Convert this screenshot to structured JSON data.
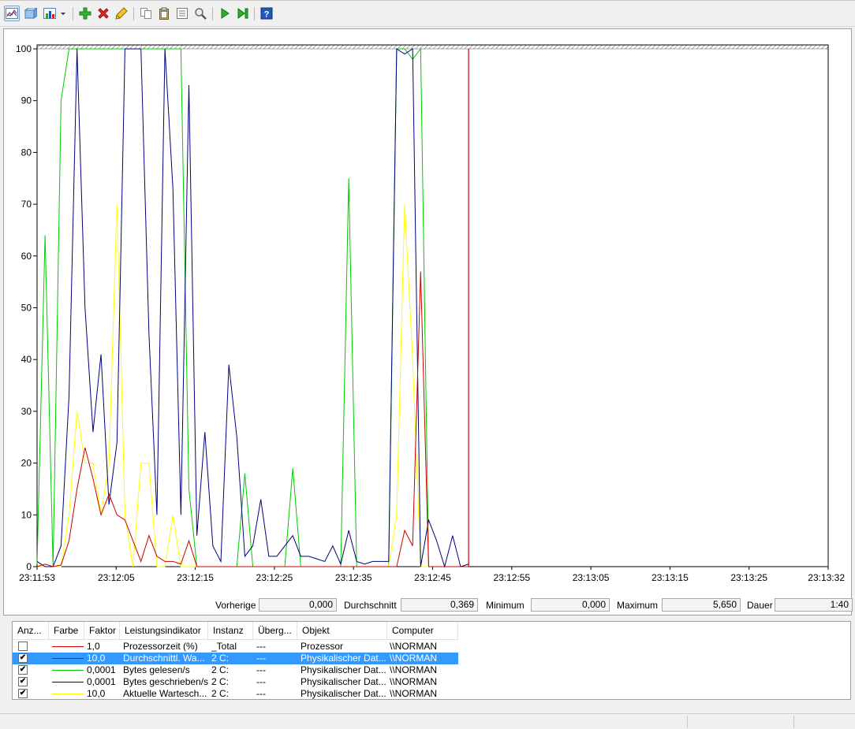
{
  "toolbar": {
    "buttons": [
      {
        "icon": "graph-view-icon",
        "active": true
      },
      {
        "icon": "change-graph-type-icon"
      },
      {
        "icon": "graph-type-dropdown-icon"
      },
      {
        "icon": "add-counter-icon",
        "color": "#2fa22f"
      },
      {
        "icon": "delete-counter-icon",
        "color": "#d02020"
      },
      {
        "icon": "highlight-icon",
        "color": "#c9a000"
      },
      {
        "icon": "copy-properties-icon"
      },
      {
        "icon": "paste-counter-list-icon"
      },
      {
        "icon": "properties-icon"
      },
      {
        "icon": "zoom-icon"
      },
      {
        "icon": "unfreeze-display-icon",
        "color": "#1e9a1e"
      },
      {
        "icon": "update-data-icon",
        "color": "#1e9a1e"
      },
      {
        "icon": "help-icon",
        "color": "#2050a0"
      }
    ]
  },
  "chart_data": {
    "type": "line",
    "ylim": [
      0,
      100
    ],
    "yticks": [
      "0",
      "10",
      "20",
      "30",
      "40",
      "50",
      "60",
      "70",
      "80",
      "90",
      "100"
    ],
    "xticks": [
      "23:11:53",
      "23:12:05",
      "23:12:15",
      "23:12:25",
      "23:12:35",
      "23:12:45",
      "23:12:55",
      "23:13:05",
      "23:13:15",
      "23:13:25",
      "23:13:32"
    ],
    "time_range_seconds": [
      0,
      99
    ],
    "current_time_marker": 54,
    "series": [
      {
        "color": "#cc0000",
        "values": [
          0,
          0.5,
          0,
          0.3,
          5,
          15,
          23,
          17,
          10,
          14,
          10,
          9,
          5,
          1,
          6,
          2,
          1,
          1,
          0.5,
          5,
          0,
          0,
          0,
          0,
          0,
          0,
          0,
          0,
          0,
          0,
          0,
          0,
          0,
          0,
          0,
          0,
          0,
          0,
          0,
          0,
          0,
          0,
          0,
          0,
          0,
          0,
          7,
          4,
          57,
          0,
          0,
          0,
          0,
          0,
          0
        ]
      },
      {
        "color": "#00cc00",
        "values": [
          0.5,
          64,
          0,
          90,
          100,
          100,
          100,
          100,
          100,
          100,
          100,
          100,
          100,
          100,
          100,
          100,
          100,
          100,
          100,
          15,
          0,
          0,
          0,
          0,
          0,
          0,
          18,
          0,
          0,
          0,
          0,
          0,
          19,
          0,
          0,
          0,
          0,
          0,
          0,
          75,
          0,
          0,
          0,
          0,
          0,
          100,
          100,
          98,
          100,
          0,
          0,
          0,
          0,
          0,
          0
        ]
      },
      {
        "color": "#000080",
        "values": [
          1,
          0,
          0,
          4,
          33,
          100,
          50,
          26,
          41,
          12,
          24,
          100,
          100,
          100,
          45,
          10,
          100,
          73,
          10,
          93,
          6,
          26,
          4,
          1,
          39,
          25,
          2,
          4,
          13,
          2,
          2,
          4,
          6,
          2,
          2,
          1.5,
          1,
          4,
          0.5,
          7,
          1,
          0.5,
          1,
          1,
          1,
          100,
          99,
          101,
          0,
          9,
          5,
          0,
          6,
          0,
          0.5
        ]
      },
      {
        "color": "#ffff00",
        "values": [
          0,
          0,
          0,
          0,
          10,
          30,
          20,
          20,
          10,
          20,
          70,
          10,
          0,
          20,
          20,
          0,
          0,
          10,
          0,
          0,
          0,
          0,
          0,
          0,
          0,
          0,
          0,
          0,
          0,
          0,
          0,
          0,
          0,
          0,
          0,
          0,
          0,
          0,
          0,
          0,
          0,
          0,
          0,
          0,
          0,
          10,
          70,
          40,
          0,
          0,
          0,
          0,
          0,
          0,
          0
        ]
      }
    ]
  },
  "stats": {
    "last_label": "Vorherige",
    "last_value": "0,000",
    "avg_label": "Durchschnitt",
    "avg_value": "0,369",
    "min_label": "Minimum",
    "min_value": "0,000",
    "max_label": "Maximum",
    "max_value": "5,650",
    "dur_label": "Dauer",
    "dur_value": "1:40"
  },
  "legend": {
    "headers": [
      "Anz...",
      "Farbe",
      "Faktor",
      "Leistungsindikator",
      "Instanz",
      "Überg...",
      "Objekt",
      "Computer"
    ],
    "rows": [
      {
        "checked": false,
        "color": "#cc0000",
        "factor": "1,0",
        "counter": "Prozessorzeit (%)",
        "instance": "_Total",
        "parent": "---",
        "object": "Prozessor",
        "computer": "\\\\NORMAN"
      },
      {
        "checked": true,
        "selected": true,
        "color": "#cc0000",
        "factor": "10,0",
        "counter": "Durchschnittl. Wa...",
        "instance": "2 C:",
        "parent": "---",
        "object": "Physikalischer Dat...",
        "computer": "\\\\NORMAN"
      },
      {
        "checked": true,
        "color": "#00cc00",
        "factor": "0,0001",
        "counter": "Bytes gelesen/s",
        "instance": "2 C:",
        "parent": "---",
        "object": "Physikalischer Dat...",
        "computer": "\\\\NORMAN"
      },
      {
        "checked": true,
        "color": "#000080",
        "factor": "0,0001",
        "counter": "Bytes geschrieben/s",
        "instance": "2 C:",
        "parent": "---",
        "object": "Physikalischer Dat...",
        "computer": "\\\\NORMAN"
      },
      {
        "checked": true,
        "color": "#ffff00",
        "factor": "10,0",
        "counter": "Aktuelle Wartesch...",
        "instance": "2 C:",
        "parent": "---",
        "object": "Physikalischer Dat...",
        "computer": "\\\\NORMAN"
      }
    ]
  }
}
